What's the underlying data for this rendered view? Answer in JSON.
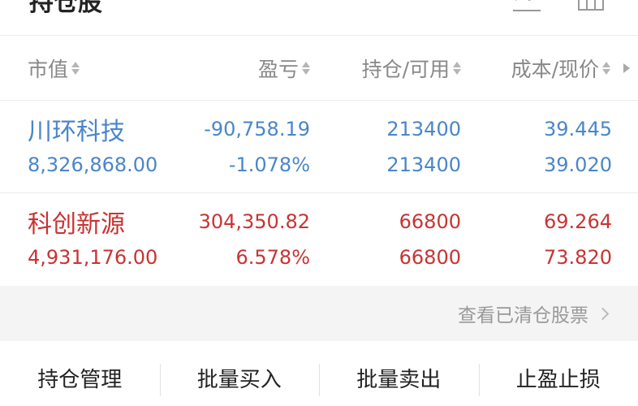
{
  "header": {
    "title": "持仓股",
    "icons": [
      "chart-icon",
      "grid-icon"
    ]
  },
  "columns": {
    "market_value": "市值",
    "profit_loss": "盈亏",
    "position": "持仓/可用",
    "cost_price": "成本/现价"
  },
  "holdings": [
    {
      "name": "川环科技",
      "market_value": "8,326,868.00",
      "profit_loss": "-90,758.19",
      "profit_loss_pct": "-1.078%",
      "position": "213400",
      "available": "213400",
      "cost": "39.445",
      "price": "39.020",
      "color": "#4a86c8"
    },
    {
      "name": "科创新源",
      "market_value": "4,931,176.00",
      "profit_loss": "304,350.82",
      "profit_loss_pct": "6.578%",
      "position": "66800",
      "available": "66800",
      "cost": "69.264",
      "price": "73.820",
      "color": "#c93333"
    }
  ],
  "cleared_link": "查看已清仓股票",
  "actions": [
    "持仓管理",
    "批量买入",
    "批量卖出",
    "止盈止损"
  ]
}
